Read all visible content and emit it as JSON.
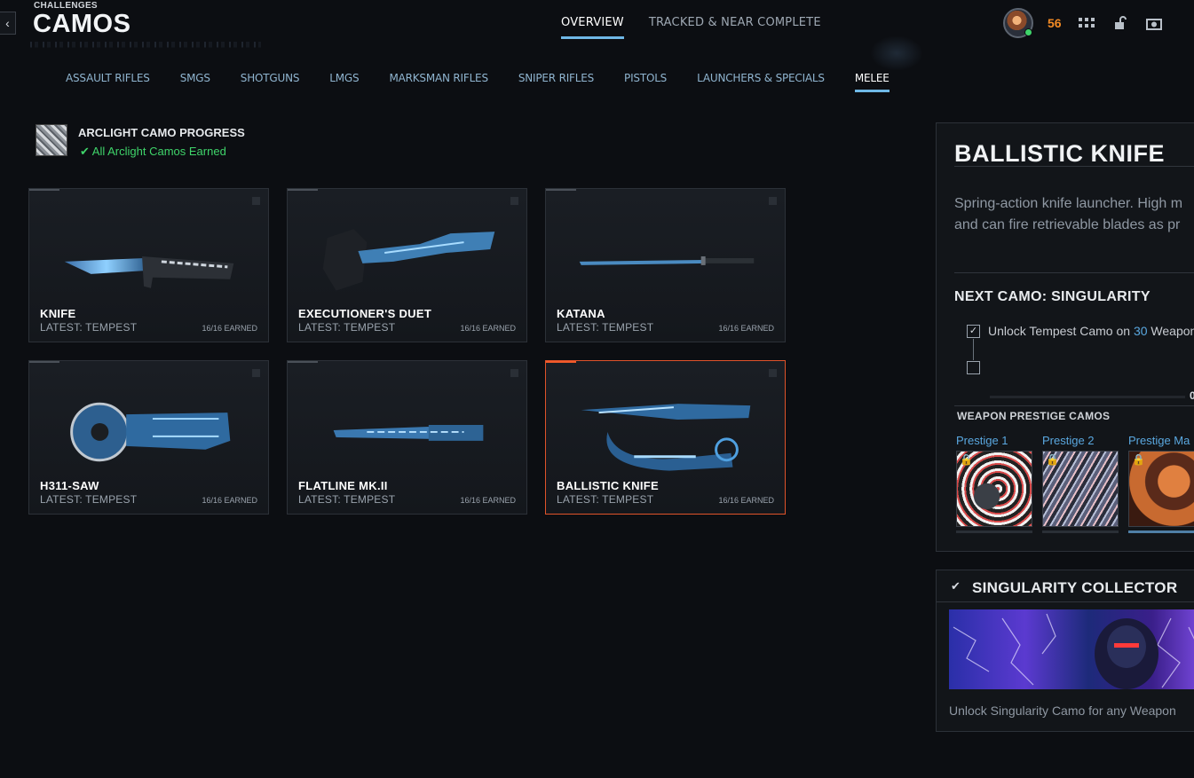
{
  "header": {
    "breadcrumb": "CHALLENGES",
    "title": "CAMOS",
    "back_icon": "chevron-left-icon",
    "tabs": [
      {
        "label": "OVERVIEW",
        "active": true
      },
      {
        "label": "TRACKED & NEAR COMPLETE",
        "active": false
      }
    ],
    "level": "56",
    "level_color": "#f28a24",
    "icons": [
      "grid-icon",
      "unlock-icon",
      "camera-icon"
    ]
  },
  "categories": [
    {
      "label": "ASSAULT RIFLES",
      "active": false
    },
    {
      "label": "SMGS",
      "active": false
    },
    {
      "label": "SHOTGUNS",
      "active": false
    },
    {
      "label": "LMGS",
      "active": false
    },
    {
      "label": "MARKSMAN RIFLES",
      "active": false
    },
    {
      "label": "SNIPER RIFLES",
      "active": false
    },
    {
      "label": "PISTOLS",
      "active": false
    },
    {
      "label": "LAUNCHERS & SPECIALS",
      "active": false
    },
    {
      "label": "MELEE",
      "active": true
    }
  ],
  "progress": {
    "title": "ARCLIGHT CAMO PROGRESS",
    "status": "All Arclight Camos Earned",
    "status_color": "#3fd46a"
  },
  "weapons": [
    {
      "name": "KNIFE",
      "latest": "LATEST: TEMPEST",
      "earned": "16/16 EARNED",
      "selected": false
    },
    {
      "name": "EXECUTIONER'S DUET",
      "latest": "LATEST: TEMPEST",
      "earned": "16/16 EARNED",
      "selected": false
    },
    {
      "name": "KATANA",
      "latest": "LATEST: TEMPEST",
      "earned": "16/16 EARNED",
      "selected": false
    },
    {
      "name": "H311-SAW",
      "latest": "LATEST: TEMPEST",
      "earned": "16/16 EARNED",
      "selected": false
    },
    {
      "name": "FLATLINE MK.II",
      "latest": "LATEST: TEMPEST",
      "earned": "16/16 EARNED",
      "selected": false
    },
    {
      "name": "BALLISTIC KNIFE",
      "latest": "LATEST: TEMPEST",
      "earned": "16/16 EARNED",
      "selected": true
    }
  ],
  "detail": {
    "title": "BALLISTIC KNIFE",
    "desc_line1": "Spring-action knife launcher. High m",
    "desc_line2": "and can fire retrievable blades as pr",
    "next_camo": "NEXT CAMO: SINGULARITY",
    "challenge_prefix": "Unlock Tempest Camo on ",
    "challenge_count": "30",
    "challenge_suffix": " Weapons",
    "challenge_done": true,
    "progress_value": "0",
    "prestige_heading": "WEAPON PRESTIGE CAMOS",
    "prestige": [
      {
        "label": "Prestige 1",
        "locked": true,
        "progress": 0.6
      },
      {
        "label": "Prestige 2",
        "locked": true,
        "progress": 0
      },
      {
        "label": "Prestige Ma",
        "locked": true,
        "progress": 0
      }
    ]
  },
  "collector": {
    "title": "SINGULARITY COLLECTOR",
    "completed": true,
    "desc": "Unlock Singularity Camo for any Weapon"
  }
}
